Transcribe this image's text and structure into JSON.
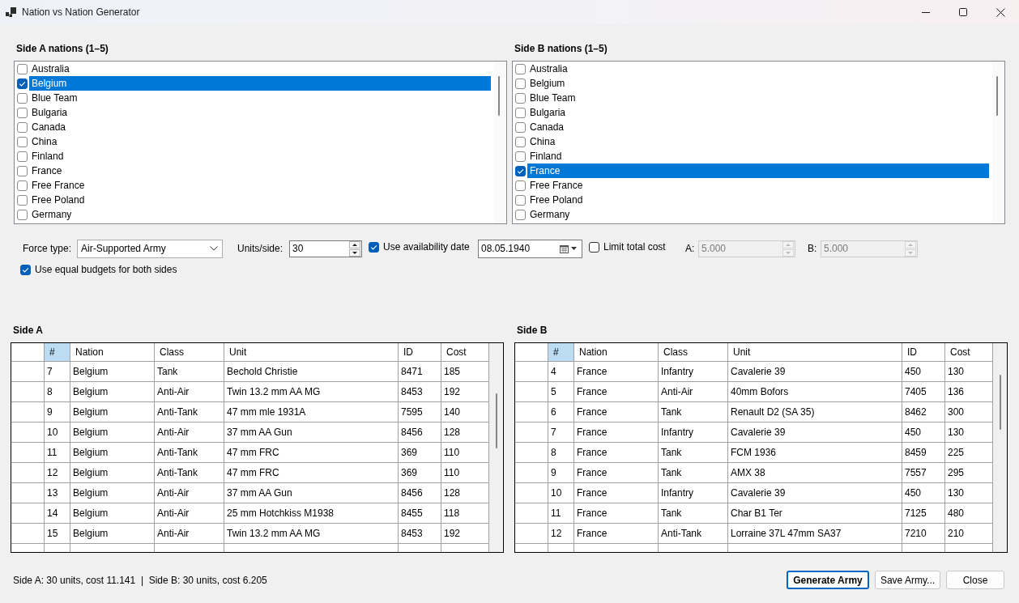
{
  "window": {
    "title": "Nation vs Nation Generator"
  },
  "side_a_nations": {
    "label": "Side A nations (1–5)",
    "items": [
      {
        "name": "Australia",
        "checked": false,
        "selected": false
      },
      {
        "name": "Belgium",
        "checked": true,
        "selected": true
      },
      {
        "name": "Blue Team",
        "checked": false,
        "selected": false
      },
      {
        "name": "Bulgaria",
        "checked": false,
        "selected": false
      },
      {
        "name": "Canada",
        "checked": false,
        "selected": false
      },
      {
        "name": "China",
        "checked": false,
        "selected": false
      },
      {
        "name": "Finland",
        "checked": false,
        "selected": false
      },
      {
        "name": "France",
        "checked": false,
        "selected": false
      },
      {
        "name": "Free France",
        "checked": false,
        "selected": false
      },
      {
        "name": "Free Poland",
        "checked": false,
        "selected": false
      },
      {
        "name": "Germany",
        "checked": false,
        "selected": false
      }
    ]
  },
  "side_b_nations": {
    "label": "Side B nations (1–5)",
    "items": [
      {
        "name": "Australia",
        "checked": false,
        "selected": false
      },
      {
        "name": "Belgium",
        "checked": false,
        "selected": false
      },
      {
        "name": "Blue Team",
        "checked": false,
        "selected": false
      },
      {
        "name": "Bulgaria",
        "checked": false,
        "selected": false
      },
      {
        "name": "Canada",
        "checked": false,
        "selected": false
      },
      {
        "name": "China",
        "checked": false,
        "selected": false
      },
      {
        "name": "Finland",
        "checked": false,
        "selected": false
      },
      {
        "name": "France",
        "checked": true,
        "selected": true
      },
      {
        "name": "Free France",
        "checked": false,
        "selected": false
      },
      {
        "name": "Free Poland",
        "checked": false,
        "selected": false
      },
      {
        "name": "Germany",
        "checked": false,
        "selected": false
      }
    ]
  },
  "options": {
    "force_type": {
      "label": "Force type:",
      "value": "Air-Supported Army"
    },
    "units_per_side": {
      "label": "Units/side:",
      "value": "30"
    },
    "use_availability_date": {
      "label": "Use availability date",
      "checked": true
    },
    "date": {
      "value": "08.05.1940"
    },
    "limit_total_cost": {
      "label": "Limit total cost",
      "checked": false
    },
    "budget_a": {
      "label": "A:",
      "value": "5.000",
      "disabled": true
    },
    "budget_b": {
      "label": "B:",
      "value": "5.000",
      "disabled": true
    },
    "equal_budgets": {
      "label": "Use equal budgets for both sides",
      "checked": true
    }
  },
  "tables": [
    {
      "label": "Side A",
      "columns": [
        {
          "label": "#",
          "selected": true
        },
        {
          "label": "Nation",
          "selected": false
        },
        {
          "label": "Class",
          "selected": false
        },
        {
          "label": "Unit",
          "selected": false
        },
        {
          "label": "ID",
          "selected": false
        },
        {
          "label": "Cost",
          "selected": false
        }
      ],
      "rows": [
        [
          "7",
          "Belgium",
          "Tank",
          "Bechold Christie",
          "8471",
          "185"
        ],
        [
          "8",
          "Belgium",
          "Anti-Air",
          "Twin 13.2 mm AA MG",
          "8453",
          "192"
        ],
        [
          "9",
          "Belgium",
          "Anti-Tank",
          "47 mm mle 1931A",
          "7595",
          "140"
        ],
        [
          "10",
          "Belgium",
          "Anti-Air",
          "37 mm AA Gun",
          "8456",
          "128"
        ],
        [
          "11",
          "Belgium",
          "Anti-Tank",
          "47 mm FRC",
          "369",
          "110"
        ],
        [
          "12",
          "Belgium",
          "Anti-Tank",
          "47 mm FRC",
          "369",
          "110"
        ],
        [
          "13",
          "Belgium",
          "Anti-Air",
          "37 mm AA Gun",
          "8456",
          "128"
        ],
        [
          "14",
          "Belgium",
          "Anti-Air",
          "25 mm Hotchkiss M1938",
          "8455",
          "118"
        ],
        [
          "15",
          "Belgium",
          "Anti-Air",
          "Twin 13.2 mm AA MG",
          "8453",
          "192"
        ]
      ]
    },
    {
      "label": "Side B",
      "columns": [
        {
          "label": "#",
          "selected": true
        },
        {
          "label": "Nation",
          "selected": false
        },
        {
          "label": "Class",
          "selected": false
        },
        {
          "label": "Unit",
          "selected": false
        },
        {
          "label": "ID",
          "selected": false
        },
        {
          "label": "Cost",
          "selected": false
        }
      ],
      "rows": [
        [
          "4",
          "France",
          "Infantry",
          "Cavalerie 39",
          "450",
          "130"
        ],
        [
          "5",
          "France",
          "Anti-Air",
          "40mm Bofors",
          "7405",
          "136"
        ],
        [
          "6",
          "France",
          "Tank",
          "Renault D2 (SA 35)",
          "8462",
          "300"
        ],
        [
          "7",
          "France",
          "Infantry",
          "Cavalerie 39",
          "450",
          "130"
        ],
        [
          "8",
          "France",
          "Tank",
          "FCM 1936",
          "8459",
          "225"
        ],
        [
          "9",
          "France",
          "Tank",
          "AMX 38",
          "7557",
          "295"
        ],
        [
          "10",
          "France",
          "Infantry",
          "Cavalerie 39",
          "450",
          "130"
        ],
        [
          "11",
          "France",
          "Tank",
          "Char B1 Ter",
          "7125",
          "480"
        ],
        [
          "12",
          "France",
          "Anti-Tank",
          "Lorraine 37L 47mm SA37",
          "7210",
          "210"
        ]
      ]
    }
  ],
  "status_bar": {
    "text": "Side A: 30 units, cost 11.141  |  Side B: 30 units, cost 6.205"
  },
  "buttons": [
    {
      "label": "Generate Army",
      "default": true
    },
    {
      "label": "Save Army...",
      "default": false
    },
    {
      "label": "Close",
      "default": false
    }
  ]
}
